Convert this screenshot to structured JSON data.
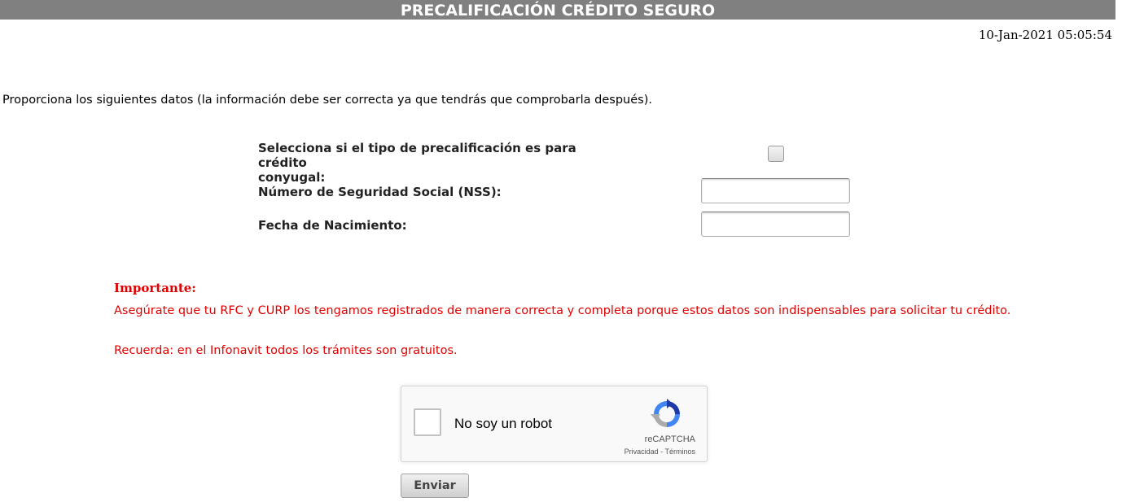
{
  "header": {
    "title": "PRECALIFICACIÓN CRÉDITO SEGURO",
    "timestamp": "10-Jan-2021 05:05:54"
  },
  "intro_text": "Proporciona los siguientes datos (la información debe ser correcta ya que tendrás que comprobarla después).",
  "form": {
    "conyugal_label_line1": "Selecciona si el tipo de precalificación es para crédito",
    "conyugal_label_line2": "conyugal:",
    "conyugal_checked": false,
    "nss_label": "Número de Seguridad Social (NSS):",
    "nss_value": "",
    "birthdate_label": "Fecha de Nacimiento:",
    "birthdate_value": ""
  },
  "notice": {
    "title": "Importante:",
    "line1": "Asegúrate que tu RFC y CURP los tengamos registrados de manera correcta y completa porque estos datos son indispensables para solicitar tu crédito.",
    "line2": "Recuerda: en el Infonavit todos los trámites son gratuitos."
  },
  "captcha": {
    "label": "No soy un robot",
    "brand": "reCAPTCHA",
    "privacy": "Privacidad",
    "separator": " - ",
    "terms": "Términos",
    "logo_icon": "recaptcha-logo-icon"
  },
  "submit_label": "Enviar",
  "colors": {
    "header_bg": "#808080",
    "notice_red": "#e00000"
  }
}
